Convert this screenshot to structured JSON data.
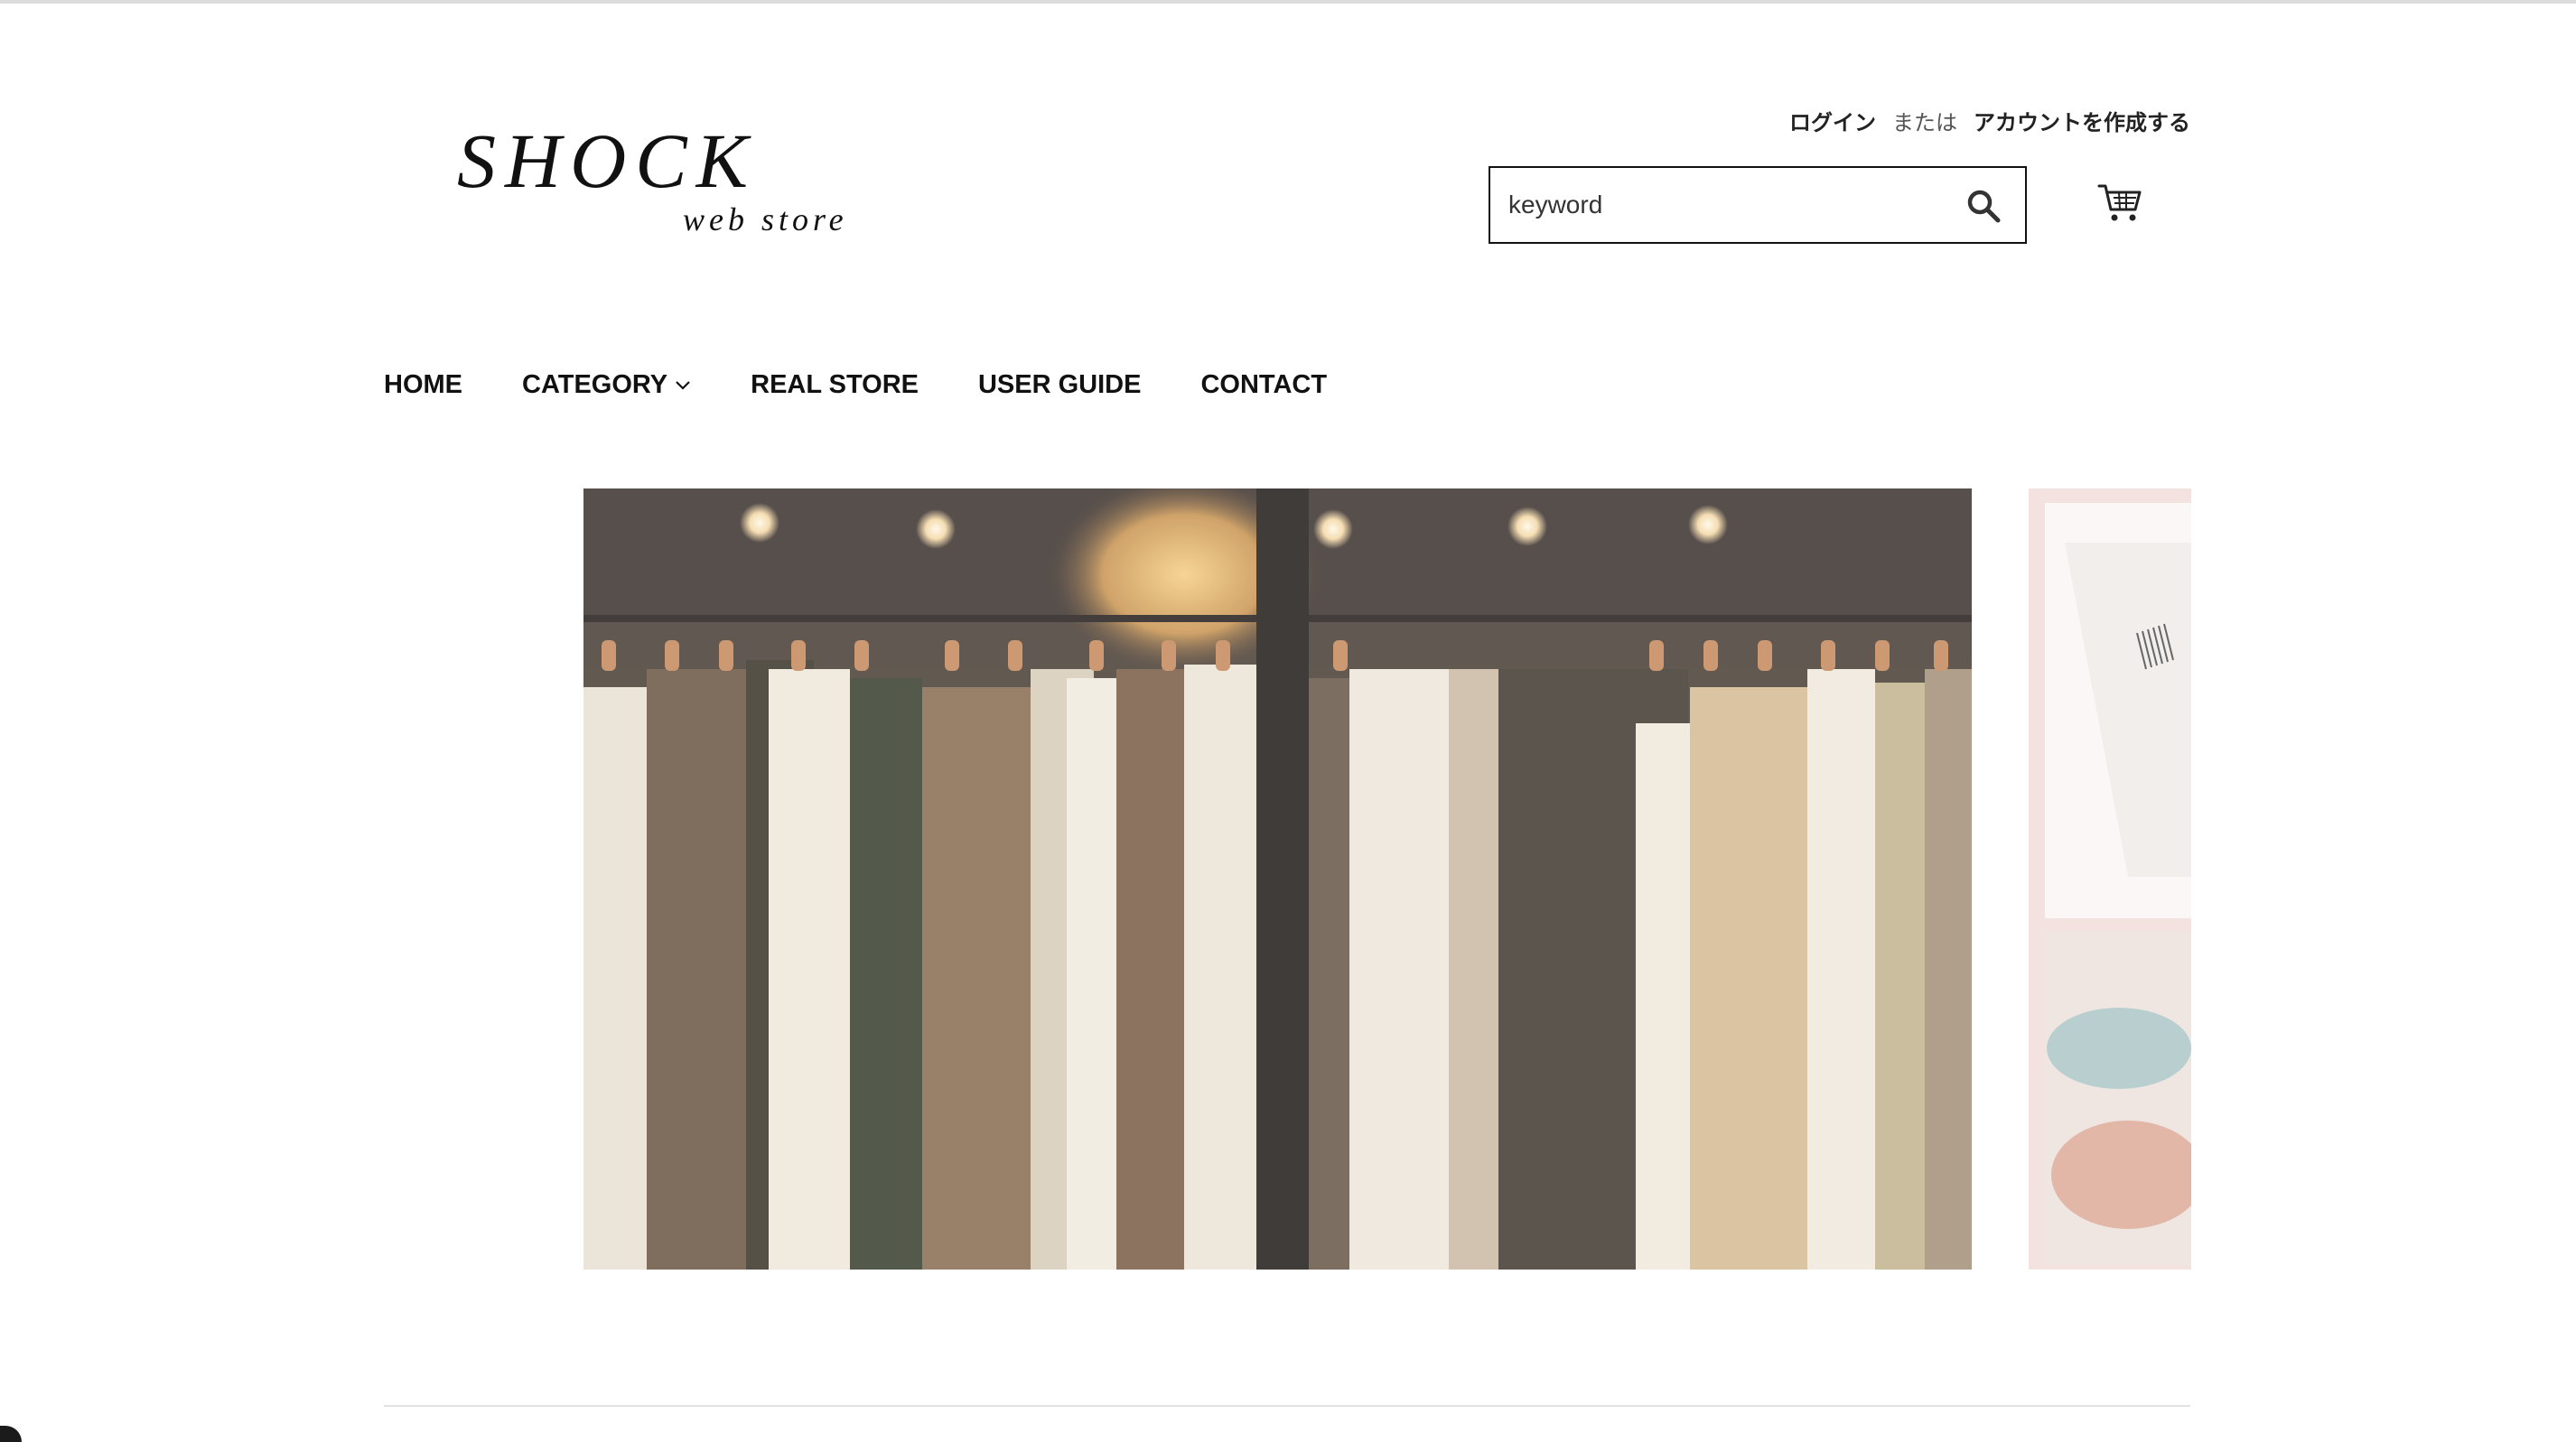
{
  "logo": {
    "main": "SHOCK",
    "sub": "web store"
  },
  "account": {
    "login": "ログイン",
    "or": "または",
    "create": "アカウントを作成する"
  },
  "search": {
    "placeholder": "keyword",
    "value": ""
  },
  "nav": {
    "items": [
      {
        "label": "HOME"
      },
      {
        "label": "CATEGORY"
      },
      {
        "label": "REAL STORE"
      },
      {
        "label": "USER GUIDE"
      },
      {
        "label": "CONTACT"
      }
    ]
  },
  "icons": {
    "search": "search-icon",
    "cart": "cart-icon",
    "category_dropdown": "chevron-down-icon"
  }
}
